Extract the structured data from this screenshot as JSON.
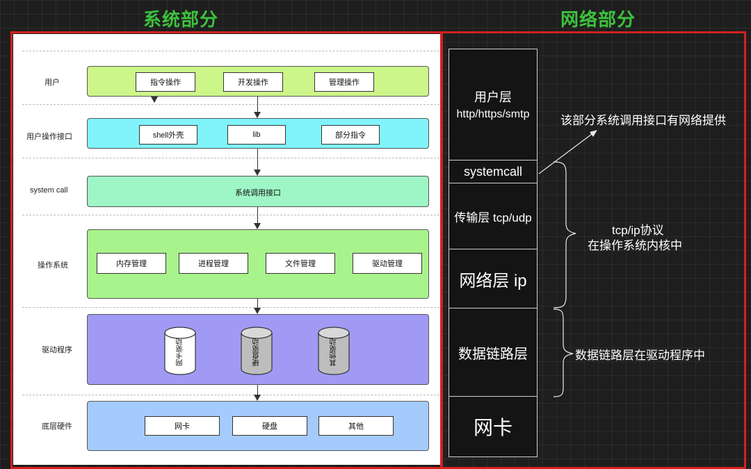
{
  "titles": {
    "system": "系统部分",
    "network": "网络部分"
  },
  "system": {
    "rows": [
      {
        "label": "用户",
        "items": [
          "指令操作",
          "开发操作",
          "管理操作"
        ],
        "color": "#ccf58a"
      },
      {
        "label": "用户操作接口",
        "items": [
          "shell外壳",
          "lib",
          "部分指令"
        ],
        "color": "#80f4fa"
      },
      {
        "label": "system call",
        "text": "系统调用接口",
        "color": "#9ef5c6"
      },
      {
        "label": "操作系统",
        "items": [
          "内存管理",
          "进程管理",
          "文件管理",
          "驱动管理"
        ],
        "color": "#a8f38c"
      },
      {
        "label": "驱动程序",
        "cylinders": [
          "网卡驱动",
          "硬盘驱动",
          "其他驱动"
        ],
        "color": "#a09af5"
      },
      {
        "label": "底层硬件",
        "items": [
          "网卡",
          "硬盘",
          "其他"
        ],
        "color": "#a4cbfb"
      }
    ]
  },
  "network": {
    "layers": [
      {
        "name": "用户层",
        "detail": "http/https/smtp"
      },
      {
        "name": "systemcall"
      },
      {
        "name": "传输层 tcp/udp"
      },
      {
        "name": "网络层 ip"
      },
      {
        "name": "数据链路层"
      },
      {
        "name": "网卡"
      }
    ],
    "notes": {
      "syscall_note": "该部分系统调用接口有网络提供",
      "tcpip_line1": "tcp/ip协议",
      "tcpip_line2": "在操作系统内核中",
      "datalink_note": "数据链路层在驱动程序中"
    }
  },
  "colors": {
    "frame": "#d42020",
    "title": "#3cc23c"
  }
}
